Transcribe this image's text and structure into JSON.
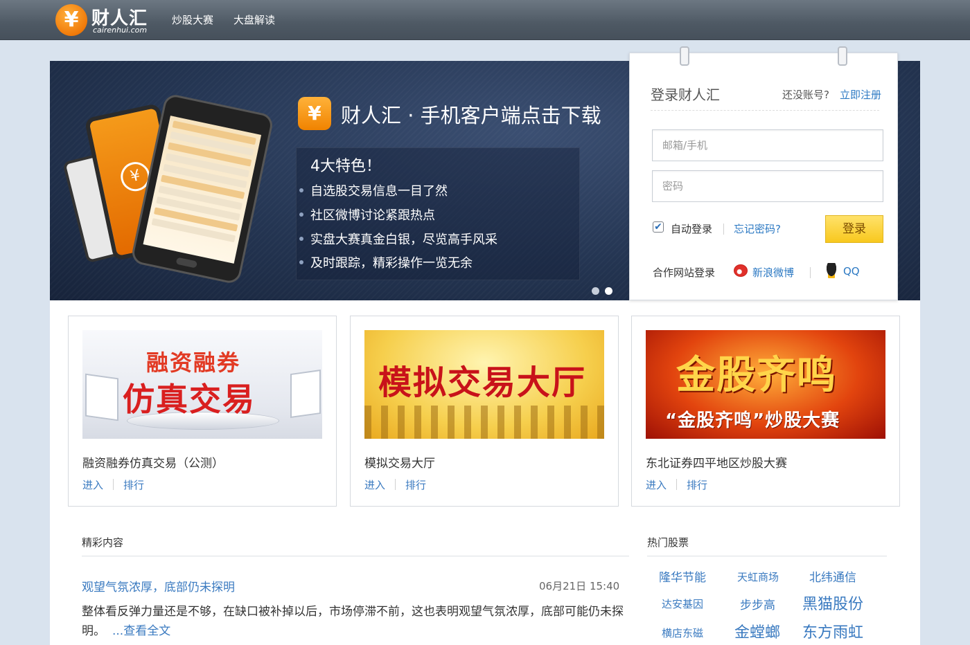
{
  "header": {
    "logo_text": "财人汇",
    "logo_domain": "cairenhui.com",
    "logo_symbol": "¥",
    "nav": [
      "炒股大赛",
      "大盘解读"
    ]
  },
  "banner": {
    "icon_symbol": "¥",
    "download_title": "财人汇 · 手机客户端点击下载",
    "features_title": "4大特色！",
    "features": [
      "自选股交易信息一目了然",
      "社区微博讨论紧跟热点",
      "实盘大赛真金白银，尽览高手风采",
      "及时跟踪，精彩操作一览无余"
    ]
  },
  "login": {
    "title": "登录财人汇",
    "no_account": "还没账号?",
    "register": "立即注册",
    "email_placeholder": "邮箱/手机",
    "password_placeholder": "密码",
    "auto_login": "自动登录",
    "auto_login_checked": true,
    "forgot": "忘记密码?",
    "submit": "登录",
    "partner_label": "合作网站登录",
    "weibo": "新浪微博",
    "qq": "QQ"
  },
  "cards": [
    {
      "image_lines": [
        "融资融券",
        "仿真交易"
      ],
      "title": "融资融券仿真交易（公测）",
      "enter": "进入",
      "rank": "排行"
    },
    {
      "image_lines": [
        "模拟交易大厅"
      ],
      "title": "模拟交易大厅",
      "enter": "进入",
      "rank": "排行"
    },
    {
      "image_lines": [
        "金股齐鸣",
        "“金股齐鸣”炒股大赛"
      ],
      "title": "东北证券四平地区炒股大赛",
      "enter": "进入",
      "rank": "排行"
    }
  ],
  "content": {
    "section_title": "精彩内容",
    "article": {
      "title": "观望气氛浓厚，底部仍未探明",
      "date": "06月21日 15:40",
      "body": "整体看反弹力量还是不够，在缺口被补掉以后，市场停滞不前，这也表明观望气氛浓厚，底部可能仍未探明。",
      "read_more": "...查看全文"
    }
  },
  "hot_stocks": {
    "title": "热门股票",
    "items": [
      "隆华节能",
      "天虹商场",
      "北纬通信",
      "达安基因",
      "步步高",
      "黑猫股份",
      "横店东磁",
      "金螳螂",
      "东方雨虹"
    ]
  }
}
